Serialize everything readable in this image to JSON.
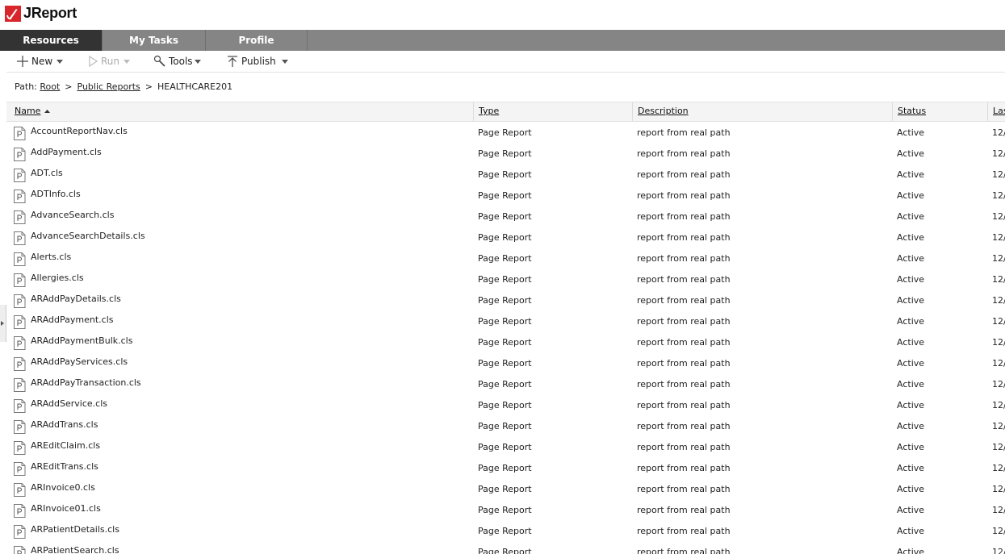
{
  "app": {
    "title": "JReport",
    "brand_color": "#d8262c"
  },
  "nav": {
    "tabs": [
      {
        "label": "Resources",
        "active": true
      },
      {
        "label": "My Tasks",
        "active": false
      },
      {
        "label": "Profile",
        "active": false
      }
    ]
  },
  "toolbar": {
    "new_label": "New",
    "run_label": "Run",
    "tools_label": "Tools",
    "publish_label": "Publish"
  },
  "path": {
    "prefix": "Path:",
    "crumbs": [
      "Root",
      "Public Reports"
    ],
    "current": "HEALTHCARE201",
    "separator": ">"
  },
  "table": {
    "columns": [
      "Name",
      "Type",
      "Description",
      "Status",
      "Las"
    ],
    "sort_column": "Name",
    "sort_direction": "ascending",
    "rows": [
      {
        "name": "AccountReportNav.cls",
        "type": "Page Report",
        "description": "report from real path",
        "status": "Active",
        "modified": "12/"
      },
      {
        "name": "AddPayment.cls",
        "type": "Page Report",
        "description": "report from real path",
        "status": "Active",
        "modified": "12/"
      },
      {
        "name": "ADT.cls",
        "type": "Page Report",
        "description": "report from real path",
        "status": "Active",
        "modified": "12/"
      },
      {
        "name": "ADTInfo.cls",
        "type": "Page Report",
        "description": "report from real path",
        "status": "Active",
        "modified": "12/"
      },
      {
        "name": "AdvanceSearch.cls",
        "type": "Page Report",
        "description": "report from real path",
        "status": "Active",
        "modified": "12/"
      },
      {
        "name": "AdvanceSearchDetails.cls",
        "type": "Page Report",
        "description": "report from real path",
        "status": "Active",
        "modified": "12/"
      },
      {
        "name": "Alerts.cls",
        "type": "Page Report",
        "description": "report from real path",
        "status": "Active",
        "modified": "12/"
      },
      {
        "name": "Allergies.cls",
        "type": "Page Report",
        "description": "report from real path",
        "status": "Active",
        "modified": "12/"
      },
      {
        "name": "ARAddPayDetails.cls",
        "type": "Page Report",
        "description": "report from real path",
        "status": "Active",
        "modified": "12/"
      },
      {
        "name": "ARAddPayment.cls",
        "type": "Page Report",
        "description": "report from real path",
        "status": "Active",
        "modified": "12/"
      },
      {
        "name": "ARAddPaymentBulk.cls",
        "type": "Page Report",
        "description": "report from real path",
        "status": "Active",
        "modified": "12/"
      },
      {
        "name": "ARAddPayServices.cls",
        "type": "Page Report",
        "description": "report from real path",
        "status": "Active",
        "modified": "12/"
      },
      {
        "name": "ARAddPayTransaction.cls",
        "type": "Page Report",
        "description": "report from real path",
        "status": "Active",
        "modified": "12/"
      },
      {
        "name": "ARAddService.cls",
        "type": "Page Report",
        "description": "report from real path",
        "status": "Active",
        "modified": "12/"
      },
      {
        "name": "ARAddTrans.cls",
        "type": "Page Report",
        "description": "report from real path",
        "status": "Active",
        "modified": "12/"
      },
      {
        "name": "AREditClaim.cls",
        "type": "Page Report",
        "description": "report from real path",
        "status": "Active",
        "modified": "12/"
      },
      {
        "name": "AREditTrans.cls",
        "type": "Page Report",
        "description": "report from real path",
        "status": "Active",
        "modified": "12/"
      },
      {
        "name": "ARInvoice0.cls",
        "type": "Page Report",
        "description": "report from real path",
        "status": "Active",
        "modified": "12/"
      },
      {
        "name": "ARInvoice01.cls",
        "type": "Page Report",
        "description": "report from real path",
        "status": "Active",
        "modified": "12/"
      },
      {
        "name": "ARPatientDetails.cls",
        "type": "Page Report",
        "description": "report from real path",
        "status": "Active",
        "modified": "12/"
      },
      {
        "name": "ARPatientSearch.cls",
        "type": "Page Report",
        "description": "report from real path",
        "status": "Active",
        "modified": "12/"
      }
    ]
  }
}
